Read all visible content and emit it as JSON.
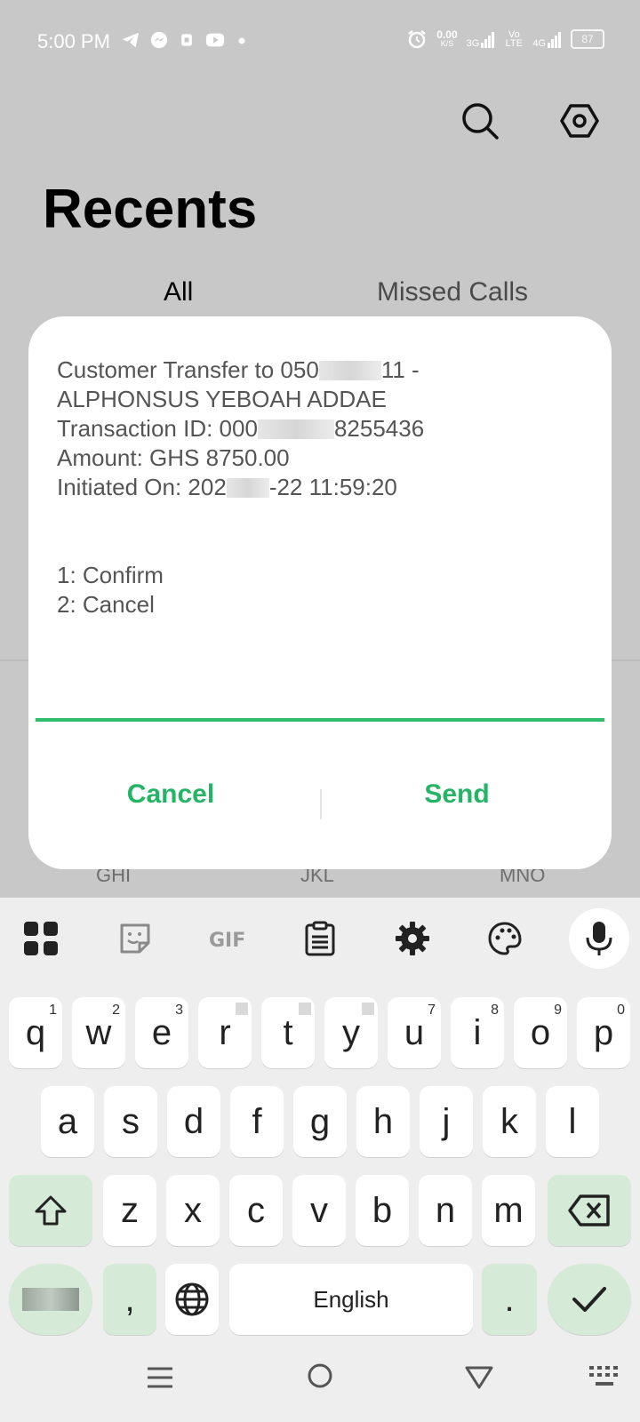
{
  "status_bar": {
    "time": "5:00 PM",
    "speed": "0.00",
    "speed_unit": "K/S",
    "net1": "3G",
    "volte": "Vo LTE",
    "net2": "4G",
    "battery": "87"
  },
  "header": {
    "title": "Recents",
    "tabs": [
      {
        "label": "All"
      },
      {
        "label": "Missed Calls"
      }
    ]
  },
  "dialpad_hints": [
    "GHI",
    "JKL",
    "MNO"
  ],
  "dialog": {
    "line1_pre": "Customer Transfer to 050",
    "line1_post": "11 -",
    "line2": "ALPHONSUS YEBOAH ADDAE",
    "line3_pre": "Transaction ID: 000",
    "line3_post": "8255436",
    "line4": "Amount: GHS 8750.00",
    "line5_pre": "Initiated On: 202",
    "line5_post": "-22 11:59:20",
    "option1": "1: Confirm",
    "option2": "2: Cancel",
    "cancel_label": "Cancel",
    "send_label": "Send"
  },
  "keyboard": {
    "row1": [
      {
        "k": "q",
        "n": "1"
      },
      {
        "k": "w",
        "n": "2"
      },
      {
        "k": "e",
        "n": "3"
      },
      {
        "k": "r",
        "n": ""
      },
      {
        "k": "t",
        "n": ""
      },
      {
        "k": "y",
        "n": ""
      },
      {
        "k": "u",
        "n": "7"
      },
      {
        "k": "i",
        "n": "8"
      },
      {
        "k": "o",
        "n": "9"
      },
      {
        "k": "p",
        "n": "0"
      }
    ],
    "row2": [
      "a",
      "s",
      "d",
      "f",
      "g",
      "h",
      "j",
      "k",
      "l"
    ],
    "row3": [
      "z",
      "x",
      "c",
      "v",
      "b",
      "n",
      "m"
    ],
    "comma": ",",
    "space_label": "English",
    "period": "."
  },
  "colors": {
    "accent": "#25b465",
    "key_green": "#d5ebd7"
  }
}
